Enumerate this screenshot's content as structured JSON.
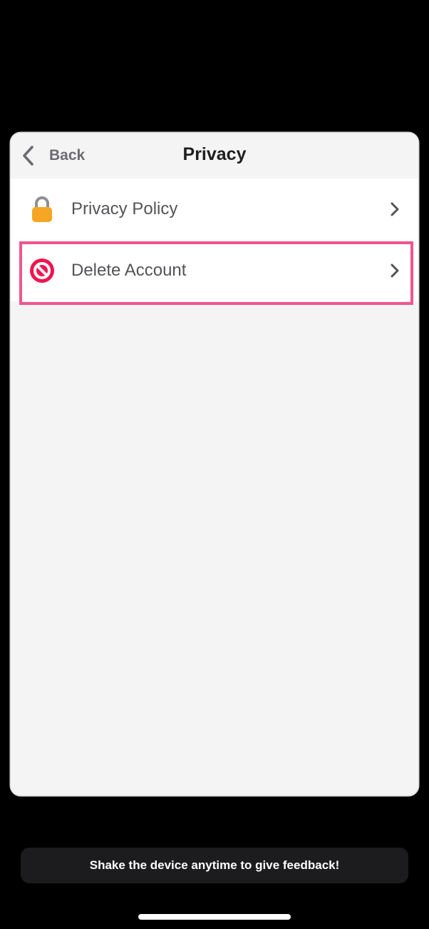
{
  "navbar": {
    "back_label": "Back",
    "title": "Privacy"
  },
  "list": {
    "items": [
      {
        "label": "Privacy Policy",
        "icon": "lock-icon",
        "icon_color": "#f5a623"
      },
      {
        "label": "Delete Account",
        "icon": "no-entry-icon",
        "icon_color": "#f0154f"
      }
    ]
  },
  "highlight_color": "#f0558f",
  "toast": {
    "text": "Shake the device anytime to give feedback!"
  }
}
